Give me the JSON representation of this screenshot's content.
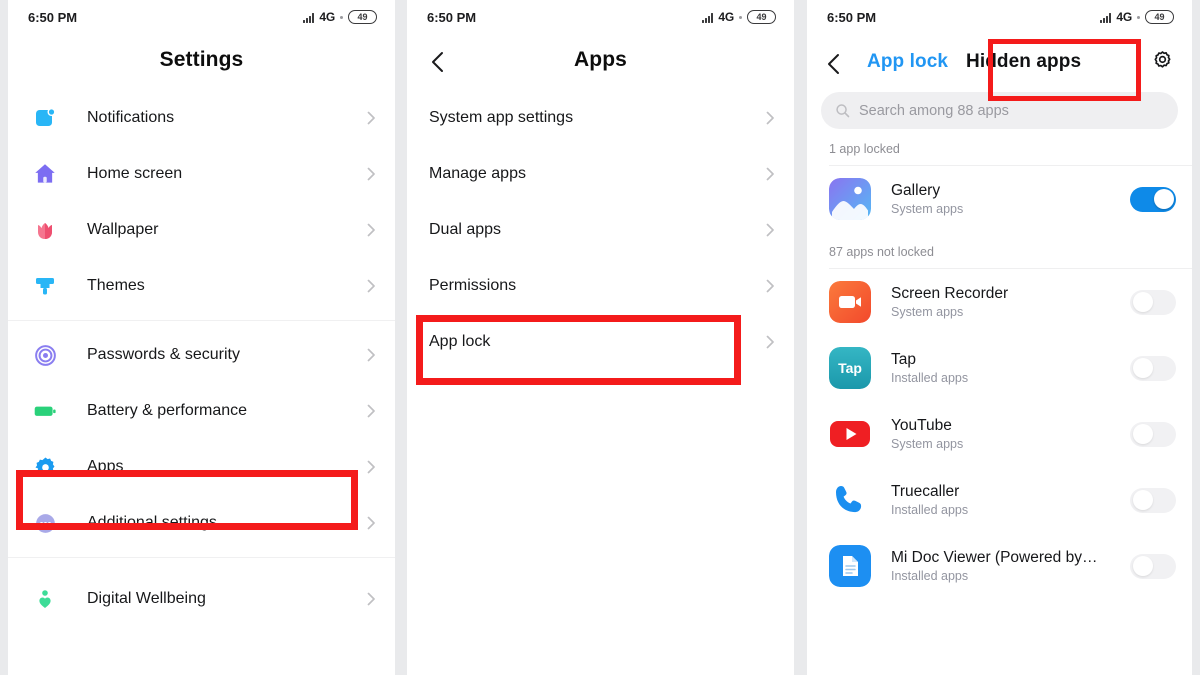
{
  "status_bar": {
    "time": "6:50 PM",
    "network": "4G",
    "battery": "49"
  },
  "panel_settings": {
    "title": "Settings",
    "groups": [
      {
        "items": [
          {
            "label": "Notifications",
            "icon": "notifications-icon"
          },
          {
            "label": "Home screen",
            "icon": "home-icon"
          },
          {
            "label": "Wallpaper",
            "icon": "wallpaper-flower-icon"
          },
          {
            "label": "Themes",
            "icon": "themes-brush-icon"
          }
        ]
      },
      {
        "items": [
          {
            "label": "Passwords & security",
            "icon": "fingerprint-icon"
          },
          {
            "label": "Battery & performance",
            "icon": "battery-icon"
          },
          {
            "label": "Apps",
            "icon": "apps-gear-icon"
          },
          {
            "label": "Additional settings",
            "icon": "additional-settings-icon"
          }
        ]
      },
      {
        "items": [
          {
            "label": "Digital Wellbeing",
            "icon": "wellbeing-person-icon"
          }
        ]
      }
    ],
    "highlight": "Apps"
  },
  "panel_apps": {
    "title": "Apps",
    "items": [
      {
        "label": "System app settings"
      },
      {
        "label": "Manage apps"
      },
      {
        "label": "Dual apps"
      },
      {
        "label": "Permissions"
      },
      {
        "label": "App lock"
      }
    ],
    "highlight": "App lock"
  },
  "panel_applock": {
    "tab_inactive": "App lock",
    "tab_active": "Hidden apps",
    "settings_icon": "gear-icon",
    "search": {
      "placeholder": "Search among 88 apps",
      "icon": "search-icon"
    },
    "section_locked": "1 app locked",
    "section_unlocked": "87 apps not locked",
    "locked_apps": [
      {
        "name": "Gallery",
        "sub": "System apps",
        "toggle": "on",
        "icon": "gallery-icon"
      }
    ],
    "unlocked_apps": [
      {
        "name": "Screen Recorder",
        "sub": "System apps",
        "toggle": "off",
        "icon": "screen-recorder-icon"
      },
      {
        "name": "Tap",
        "sub": "Installed apps",
        "toggle": "off",
        "icon": "tap-icon"
      },
      {
        "name": "YouTube",
        "sub": "System apps",
        "toggle": "off",
        "icon": "youtube-icon"
      },
      {
        "name": "Truecaller",
        "sub": "Installed apps",
        "toggle": "off",
        "icon": "truecaller-icon"
      },
      {
        "name": "Mi Doc Viewer (Powered by…",
        "sub": "Installed apps",
        "toggle": "off",
        "icon": "mi-doc-viewer-icon"
      }
    ]
  },
  "colors": {
    "accent_blue": "#0e8ae8",
    "tab_blue": "#2196f3",
    "highlight_red": "#f41b1b"
  }
}
